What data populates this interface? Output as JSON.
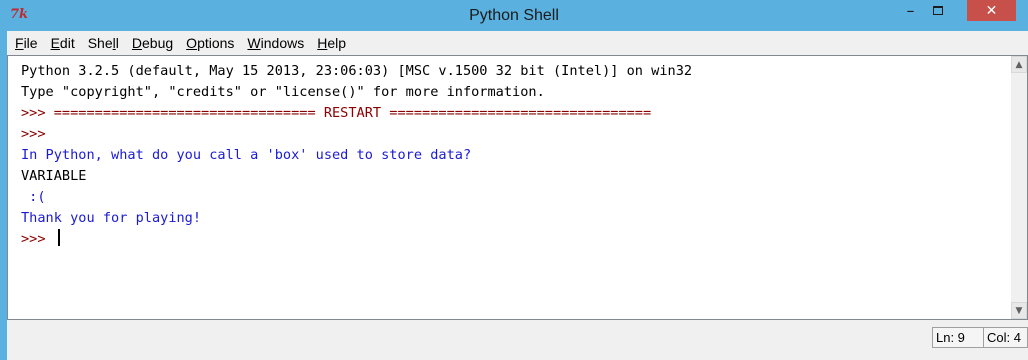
{
  "window": {
    "title": "Python Shell",
    "app_icon": "7k",
    "controls": {
      "minimize": "–",
      "close": "✕"
    }
  },
  "menubar": {
    "items": [
      {
        "pre": "",
        "key": "F",
        "post": "ile"
      },
      {
        "pre": "",
        "key": "E",
        "post": "dit"
      },
      {
        "pre": "She",
        "key": "l",
        "post": "l"
      },
      {
        "pre": "",
        "key": "D",
        "post": "ebug"
      },
      {
        "pre": "",
        "key": "O",
        "post": "ptions"
      },
      {
        "pre": "",
        "key": "W",
        "post": "indows"
      },
      {
        "pre": "",
        "key": "H",
        "post": "elp"
      }
    ]
  },
  "shell": {
    "lines": [
      {
        "text": "Python 3.2.5 (default, May 15 2013, 23:06:03) [MSC v.1500 32 bit (Intel)] on win32",
        "color": "black"
      },
      {
        "text": "Type \"copyright\", \"credits\" or \"license()\" for more information.",
        "color": "black"
      },
      {
        "text": ">>> ================================ RESTART ================================",
        "color": "maroon"
      },
      {
        "text": ">>>",
        "color": "maroon"
      },
      {
        "text": "In Python, what do you call a 'box' used to store data?",
        "color": "blue"
      },
      {
        "text": "VARIABLE",
        "color": "black"
      },
      {
        "text": " :(",
        "color": "blue"
      },
      {
        "text": "Thank you for playing!",
        "color": "blue"
      },
      {
        "text": ">>> ",
        "color": "maroon"
      }
    ],
    "colors": {
      "black": "#000000",
      "maroon": "#8b0000",
      "blue": "#1b1bd6"
    }
  },
  "scrollbar": {
    "up": "▲",
    "down": "▼"
  },
  "status": {
    "line": "Ln: 9",
    "col": "Col: 4"
  }
}
